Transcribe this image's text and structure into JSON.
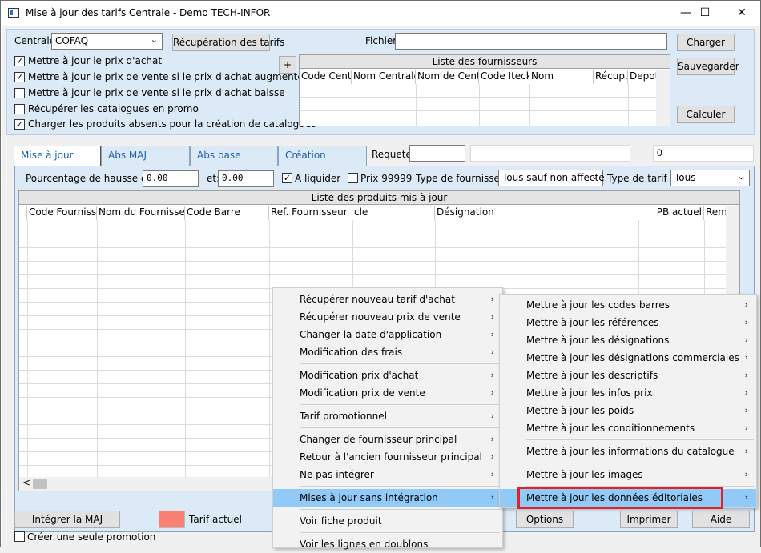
{
  "window": {
    "title": "Mise à jour des tarifs Centrale - Demo TECH-INFOR",
    "minimize": "—",
    "maximize": "☐",
    "close": "✕"
  },
  "top": {
    "centrale_label": "Centrale:",
    "centrale_value": "COFAQ",
    "recup_button": "Récupération des tarifs",
    "fichier_label": "Fichier:",
    "fichier_value": "",
    "charger_button": "Charger",
    "sauvegarder_button": "Sauvegarder",
    "calculer_button": "Calculer",
    "plus_button": "+",
    "checkboxes": [
      {
        "label": "Mettre à jour le prix d'achat",
        "checked": "✓"
      },
      {
        "label": "Mettre à jour le prix de vente si le prix d'achat augmente",
        "checked": "✓"
      },
      {
        "label": "Mettre à jour le prix de vente si le prix d'achat baisse",
        "checked": ""
      },
      {
        "label": "Récupérer les catalogues en promo",
        "checked": ""
      },
      {
        "label": "Charger les produits absents pour la création de catalogues",
        "checked": "✓"
      }
    ],
    "fournisseurs": {
      "caption": "Liste des fournisseurs",
      "columns": [
        "Code Centra",
        "Nom Centrale",
        "Nom de Centrale",
        "Code Iteck",
        "Nom",
        "Récup.?",
        "Depot"
      ]
    }
  },
  "tabs": [
    "Mise à jour",
    "Abs MAJ",
    "Abs base",
    "Création"
  ],
  "requete_label": "Requete:",
  "requete_value": "",
  "count_value": "0",
  "filters": {
    "pourcentage_label": "Pourcentage de hausse entre:",
    "min_value": "0.00",
    "et_label": "et:",
    "max_value": "0.00",
    "a_liquider_label": "A liquider",
    "a_liquider_checked": "✓",
    "prix_label": "Prix 99999",
    "prix_checked": "",
    "type_fournisseur_label": "Type de fournisseur :",
    "type_fournisseur_value": "Tous sauf non affecté",
    "type_tarif_label": "Type de tarif :",
    "type_tarif_value": "Tous"
  },
  "produits": {
    "caption": "Liste des produits mis à jour",
    "columns": [
      "Code Fournisseur",
      "Nom du Fournisseur",
      "Code Barre",
      "Ref. Fournisseur",
      "cle",
      "Désignation",
      "PB actuel",
      "Rem."
    ]
  },
  "bottom": {
    "integrer_button": "Intégrer la MAJ",
    "tarif_actuel_label": "Tarif actuel",
    "tarif_color": "#fa8072",
    "creer_promo_label": "Créer une seule promotion",
    "options_button": "Options",
    "imprimer_button": "Imprimer",
    "aide_button": "Aide"
  },
  "context_menu": {
    "items": [
      "Récupérer nouveau tarif d'achat",
      "Récupérer nouveau prix de vente",
      "Changer la date d'application",
      "Modification des frais",
      "Modification prix d'achat",
      "Modification prix de vente",
      "Tarif promotionnel",
      "Changer de fournisseur principal",
      "Retour à l'ancien fournisseur principal",
      "Ne pas intégrer",
      "Mises à jour sans intégration",
      "Voir fiche produit",
      "Voir les lignes en doublons"
    ]
  },
  "submenu": {
    "items": [
      "Mettre à jour les codes barres",
      "Mettre à jour les références",
      "Mettre à jour les désignations",
      "Mettre à jour les désignations commerciales",
      "Mettre à jour les descriptifs",
      "Mettre à jour les infos prix",
      "Mettre à jour les poids",
      "Mettre à jour les conditionnements",
      "Mettre à jour les informations du catalogue",
      "Mettre à jour les images",
      "Mettre à jour les données éditoriales"
    ],
    "highlight_color": "#e0222a"
  },
  "icons": {
    "chevron_right": "›",
    "chevron_down": "⌄",
    "scroll_left": "<"
  }
}
